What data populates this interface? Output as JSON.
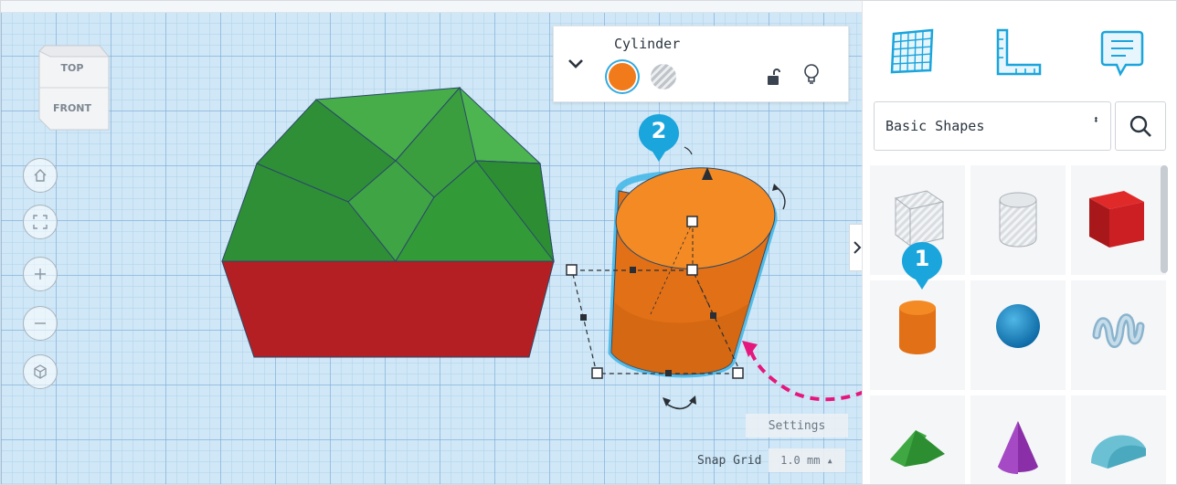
{
  "inspector": {
    "title": "Cylinder",
    "solid_color": "#f17b1a",
    "collapse_icon": "chevron-down-icon",
    "lock_icon": "unlock-icon",
    "light_icon": "lightbulb-icon"
  },
  "viewcube": {
    "top_label": "TOP",
    "front_label": "FRONT"
  },
  "nav": {
    "home_icon": "home-icon",
    "fit_icon": "fit-view-icon",
    "zoom_in_icon": "plus-icon",
    "zoom_out_icon": "minus-icon",
    "perspective_icon": "cube-perspective-icon"
  },
  "workplane": {
    "settings_label": "Settings",
    "snap_grid_label": "Snap Grid",
    "snap_grid_value": "1.0 mm ▴"
  },
  "panel": {
    "tools": [
      "workplane-icon",
      "ruler-icon",
      "notes-icon"
    ],
    "library_select": "Basic Shapes",
    "library_arrows": "⬍",
    "search_icon": "search-icon",
    "shapes": [
      "Box Hole",
      "Cylinder Hole",
      "Box",
      "Cylinder",
      "Sphere",
      "Scribble",
      "Roof",
      "Cone",
      "Round Roof"
    ]
  },
  "badges": {
    "one": "1",
    "two": "2"
  },
  "colors": {
    "accent": "#1aa5dc",
    "arrow": "#e5177d",
    "roof_green": "#3ea843",
    "box_red": "#b41f24",
    "cylinder_orange": "#f17b1a"
  }
}
